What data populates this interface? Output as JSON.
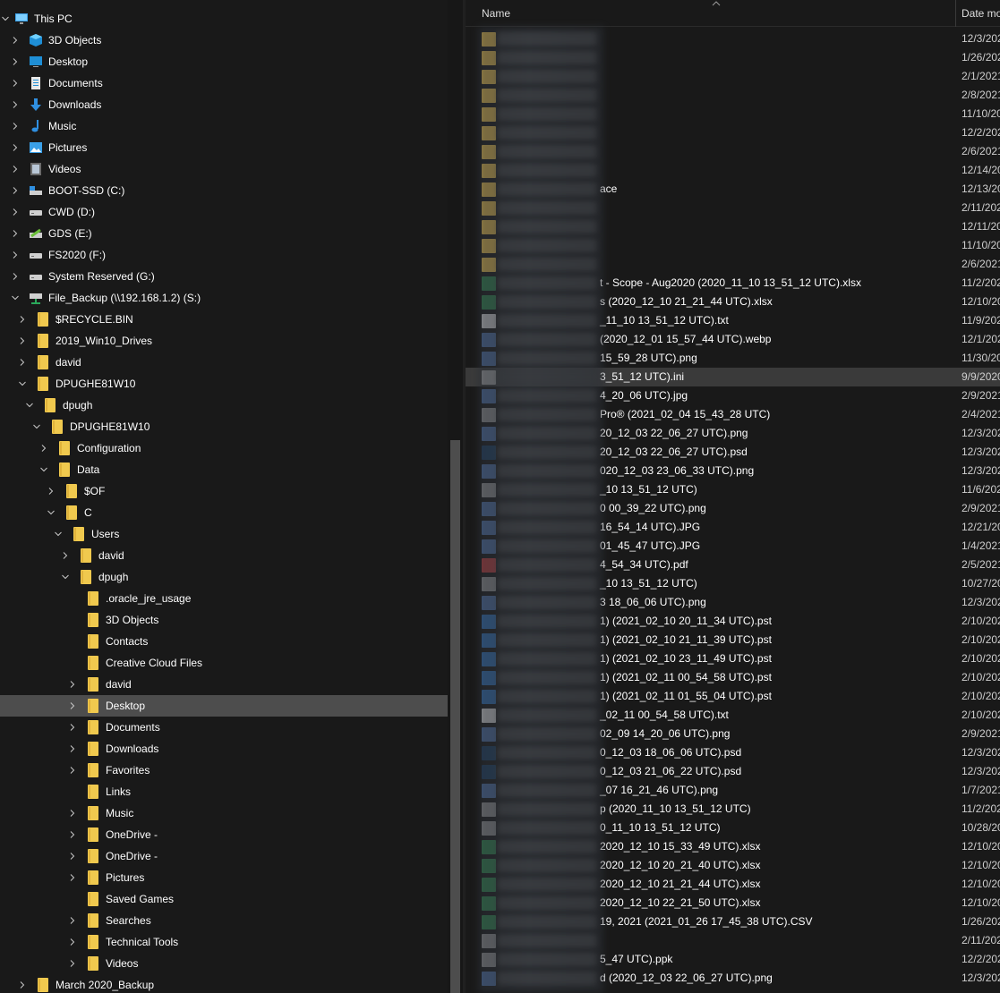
{
  "colors": {
    "background": "#191919",
    "selected": "#4d4d4d",
    "folder": "#f0c94e",
    "highlight_row": "#3a3a3a"
  },
  "nav": {
    "items": [
      {
        "label": "This PC",
        "level": 0,
        "icon": "computer-icon",
        "expand": "open"
      },
      {
        "label": "3D Objects",
        "level": 1,
        "icon": "3d-objects-icon",
        "expand": "closed"
      },
      {
        "label": "Desktop",
        "level": 1,
        "icon": "desktop-icon",
        "expand": "closed"
      },
      {
        "label": "Documents",
        "level": 1,
        "icon": "documents-icon",
        "expand": "closed"
      },
      {
        "label": "Downloads",
        "level": 1,
        "icon": "downloads-icon",
        "expand": "closed"
      },
      {
        "label": "Music",
        "level": 1,
        "icon": "music-icon",
        "expand": "closed"
      },
      {
        "label": "Pictures",
        "level": 1,
        "icon": "pictures-icon",
        "expand": "closed"
      },
      {
        "label": "Videos",
        "level": 1,
        "icon": "videos-icon",
        "expand": "closed"
      },
      {
        "label": "BOOT-SSD (C:)",
        "level": 1,
        "icon": "system-drive-icon",
        "expand": "closed"
      },
      {
        "label": "CWD (D:)",
        "level": 1,
        "icon": "drive-icon",
        "expand": "closed"
      },
      {
        "label": "GDS (E:)",
        "level": 1,
        "icon": "drive-green-icon",
        "expand": "closed"
      },
      {
        "label": "FS2020 (F:)",
        "level": 1,
        "icon": "drive-icon",
        "expand": "closed"
      },
      {
        "label": "System Reserved (G:)",
        "level": 1,
        "icon": "drive-icon",
        "expand": "closed"
      },
      {
        "label": "File_Backup (\\\\192.168.1.2) (S:)",
        "level": 1,
        "icon": "network-drive-icon",
        "expand": "open"
      },
      {
        "label": "$RECYCLE.BIN",
        "level": 2,
        "icon": "folder-icon",
        "expand": "closed"
      },
      {
        "label": "2019_Win10_Drives",
        "level": 2,
        "icon": "folder-icon",
        "expand": "closed"
      },
      {
        "label": "david",
        "level": 2,
        "icon": "folder-icon",
        "expand": "closed"
      },
      {
        "label": "DPUGHE81W10",
        "level": 2,
        "icon": "folder-icon",
        "expand": "open"
      },
      {
        "label": "dpugh",
        "level": 3,
        "icon": "folder-icon",
        "expand": "open"
      },
      {
        "label": "DPUGHE81W10",
        "level": 4,
        "icon": "folder-icon",
        "expand": "open"
      },
      {
        "label": "Configuration",
        "level": 5,
        "icon": "folder-icon",
        "expand": "closed"
      },
      {
        "label": "Data",
        "level": 5,
        "icon": "folder-icon",
        "expand": "open"
      },
      {
        "label": "$OF",
        "level": 6,
        "icon": "folder-icon",
        "expand": "closed"
      },
      {
        "label": "C",
        "level": 6,
        "icon": "folder-icon",
        "expand": "open"
      },
      {
        "label": "Users",
        "level": 7,
        "icon": "folder-icon",
        "expand": "open"
      },
      {
        "label": "david",
        "level": 8,
        "icon": "folder-icon",
        "expand": "closed"
      },
      {
        "label": "dpugh",
        "level": 8,
        "icon": "folder-icon",
        "expand": "open"
      },
      {
        "label": ".oracle_jre_usage",
        "level": 9,
        "icon": "folder-icon",
        "expand": "none"
      },
      {
        "label": "3D Objects",
        "level": 9,
        "icon": "folder-icon",
        "expand": "none"
      },
      {
        "label": "Contacts",
        "level": 9,
        "icon": "folder-icon",
        "expand": "none"
      },
      {
        "label": "Creative Cloud Files",
        "level": 9,
        "icon": "folder-icon",
        "expand": "none"
      },
      {
        "label": "david",
        "level": 9,
        "icon": "folder-icon",
        "expand": "closed"
      },
      {
        "label": "Desktop",
        "level": 9,
        "icon": "folder-icon",
        "expand": "closed",
        "selected": true
      },
      {
        "label": "Documents",
        "level": 9,
        "icon": "folder-icon",
        "expand": "closed"
      },
      {
        "label": "Downloads",
        "level": 9,
        "icon": "folder-icon",
        "expand": "closed"
      },
      {
        "label": "Favorites",
        "level": 9,
        "icon": "folder-icon",
        "expand": "closed"
      },
      {
        "label": "Links",
        "level": 9,
        "icon": "folder-icon",
        "expand": "none"
      },
      {
        "label": "Music",
        "level": 9,
        "icon": "folder-icon",
        "expand": "closed"
      },
      {
        "label": "OneDrive - ",
        "level": 9,
        "icon": "folder-icon",
        "expand": "closed"
      },
      {
        "label": "OneDrive - ",
        "level": 9,
        "icon": "folder-icon",
        "expand": "closed"
      },
      {
        "label": "Pictures",
        "level": 9,
        "icon": "folder-icon",
        "expand": "closed"
      },
      {
        "label": "Saved Games",
        "level": 9,
        "icon": "folder-icon",
        "expand": "none"
      },
      {
        "label": "Searches",
        "level": 9,
        "icon": "folder-icon",
        "expand": "closed"
      },
      {
        "label": "Technical Tools",
        "level": 9,
        "icon": "folder-icon",
        "expand": "closed"
      },
      {
        "label": "Videos",
        "level": 9,
        "icon": "folder-icon",
        "expand": "closed"
      },
      {
        "label": "March 2020_Backup",
        "level": 2,
        "icon": "folder-icon",
        "expand": "closed"
      }
    ]
  },
  "list": {
    "header": {
      "name": "Name",
      "date": "Date mo"
    },
    "rows": [
      {
        "name": "",
        "date": "12/3/202",
        "type": "folder"
      },
      {
        "name": "",
        "date": "1/26/202",
        "type": "folder"
      },
      {
        "name": "",
        "date": "2/1/2021",
        "type": "folder"
      },
      {
        "name": "",
        "date": "2/8/2021",
        "type": "folder"
      },
      {
        "name": "",
        "date": "11/10/20",
        "type": "folder"
      },
      {
        "name": "",
        "date": "12/2/202",
        "type": "folder"
      },
      {
        "name": "",
        "date": "2/6/2021",
        "type": "folder"
      },
      {
        "name": "",
        "date": "12/14/20",
        "type": "folder"
      },
      {
        "name": "ace",
        "date": "12/13/20",
        "type": "folder"
      },
      {
        "name": "",
        "date": "2/11/202",
        "type": "folder"
      },
      {
        "name": "",
        "date": "12/11/20",
        "type": "folder"
      },
      {
        "name": "",
        "date": "11/10/20",
        "type": "folder"
      },
      {
        "name": "",
        "date": "2/6/2021",
        "type": "folder"
      },
      {
        "name": "t - Scope - Aug2020 (2020_11_10 13_51_12 UTC).xlsx",
        "date": "11/2/202",
        "type": "xlsx"
      },
      {
        "name": "s (2020_12_10 21_21_44 UTC).xlsx",
        "date": "12/10/20",
        "type": "xlsx"
      },
      {
        "name": "_11_10 13_51_12 UTC).txt",
        "date": "11/9/202",
        "type": "txt"
      },
      {
        "name": "(2020_12_01 15_57_44 UTC).webp",
        "date": "12/1/202",
        "type": "image"
      },
      {
        "name": "15_59_28 UTC).png",
        "date": "11/30/20",
        "type": "image"
      },
      {
        "name": "3_51_12 UTC).ini",
        "date": "9/9/2020",
        "type": "ini"
      },
      {
        "name": "4_20_06 UTC).jpg",
        "date": "2/9/2021",
        "type": "image"
      },
      {
        "name": "Pro® (2021_02_04 15_43_28 UTC)",
        "date": "2/4/2021",
        "type": "file"
      },
      {
        "name": "20_12_03 22_06_27 UTC).png",
        "date": "12/3/202",
        "type": "image"
      },
      {
        "name": "20_12_03 22_06_27 UTC).psd",
        "date": "12/3/202",
        "type": "psd"
      },
      {
        "name": "020_12_03 23_06_33 UTC).png",
        "date": "12/3/202",
        "type": "image"
      },
      {
        "name": "_10 13_51_12 UTC)",
        "date": "11/6/202",
        "type": "file"
      },
      {
        "name": "0 00_39_22 UTC).png",
        "date": "2/9/2021",
        "type": "image"
      },
      {
        "name": "16_54_14 UTC).JPG",
        "date": "12/21/20",
        "type": "image"
      },
      {
        "name": "01_45_47 UTC).JPG",
        "date": "1/4/2021",
        "type": "image"
      },
      {
        "name": "4_54_34 UTC).pdf",
        "date": "2/5/2021",
        "type": "pdf"
      },
      {
        "name": "_10 13_51_12 UTC)",
        "date": "10/27/20",
        "type": "file"
      },
      {
        "name": "3 18_06_06 UTC).png",
        "date": "12/3/202",
        "type": "image"
      },
      {
        "name": "1) (2021_02_10 20_11_34 UTC).pst",
        "date": "2/10/202",
        "type": "pst"
      },
      {
        "name": "1) (2021_02_10 21_11_39 UTC).pst",
        "date": "2/10/202",
        "type": "pst"
      },
      {
        "name": "1) (2021_02_10 23_11_49 UTC).pst",
        "date": "2/10/202",
        "type": "pst"
      },
      {
        "name": "1) (2021_02_11 00_54_58 UTC).pst",
        "date": "2/10/202",
        "type": "pst"
      },
      {
        "name": "1) (2021_02_11 01_55_04 UTC).pst",
        "date": "2/10/202",
        "type": "pst"
      },
      {
        "name": "_02_11 00_54_58 UTC).txt",
        "date": "2/10/202",
        "type": "txt"
      },
      {
        "name": "02_09 14_20_06 UTC).png",
        "date": "2/9/2021",
        "type": "image"
      },
      {
        "name": "0_12_03 18_06_06 UTC).psd",
        "date": "12/3/202",
        "type": "psd"
      },
      {
        "name": "0_12_03 21_06_22 UTC).psd",
        "date": "12/3/202",
        "type": "psd"
      },
      {
        "name": "_07 16_21_46 UTC).png",
        "date": "1/7/2021",
        "type": "image"
      },
      {
        "name": "p (2020_11_10 13_51_12 UTC)",
        "date": "11/2/202",
        "type": "file"
      },
      {
        "name": "0_11_10 13_51_12 UTC)",
        "date": "10/28/20",
        "type": "file"
      },
      {
        "name": "2020_12_10 15_33_49 UTC).xlsx",
        "date": "12/10/20",
        "type": "xlsx"
      },
      {
        "name": "2020_12_10 20_21_40 UTC).xlsx",
        "date": "12/10/20",
        "type": "xlsx"
      },
      {
        "name": "2020_12_10 21_21_44 UTC).xlsx",
        "date": "12/10/20",
        "type": "xlsx"
      },
      {
        "name": "2020_12_10 22_21_50 UTC).xlsx",
        "date": "12/10/20",
        "type": "xlsx"
      },
      {
        "name": "19, 2021 (2021_01_26 17_45_38 UTC).CSV",
        "date": "1/26/202",
        "type": "csv"
      },
      {
        "name": "",
        "date": "2/11/202",
        "type": "file"
      },
      {
        "name": "5_47 UTC).ppk",
        "date": "12/2/202",
        "type": "file"
      },
      {
        "name": "d (2020_12_03 22_06_27 UTC).png",
        "date": "12/3/202",
        "type": "image"
      }
    ]
  }
}
